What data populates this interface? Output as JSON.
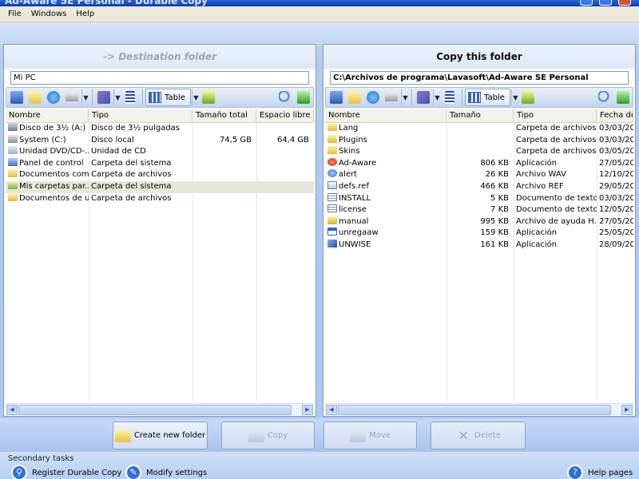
{
  "window": {
    "title": "Ad-Aware SE Personal - Durable Copy"
  },
  "menu": [
    {
      "label": "File",
      "key": "F"
    },
    {
      "label": "Windows",
      "key": "W"
    },
    {
      "label": "Help",
      "key": "H"
    }
  ],
  "left_panel": {
    "header": "-> Destination folder",
    "path": "Mi PC",
    "view_label": "Table",
    "columns": [
      "Nombre",
      "Tipo",
      "Tamaño total",
      "Espacio libre"
    ],
    "rows": [
      {
        "name": "Disco de 3½ (A:)",
        "type": "Disco de 3½ pulgadas",
        "total": "",
        "free": "",
        "icon": "floppy-icon"
      },
      {
        "name": "System (C:)",
        "type": "Disco local",
        "total": "74,5 GB",
        "free": "64,4 GB",
        "icon": "hard-drive-icon"
      },
      {
        "name": "Unidad DVD/CD-...",
        "type": "Unidad de CD",
        "total": "",
        "free": "",
        "icon": "cd-drive-icon"
      },
      {
        "name": "Panel de control",
        "type": "Carpeta del sistema",
        "total": "",
        "free": "",
        "icon": "control-panel-icon"
      },
      {
        "name": "Documentos com...",
        "type": "Carpeta de archivos",
        "total": "",
        "free": "",
        "icon": "folder-icon"
      },
      {
        "name": "Mis carpetas par...",
        "type": "Carpeta del sistema",
        "total": "",
        "free": "",
        "icon": "shared-folder-icon"
      },
      {
        "name": "Documentos de u...",
        "type": "Carpeta de archivos",
        "total": "",
        "free": "",
        "icon": "folder-icon"
      }
    ]
  },
  "right_panel": {
    "header": "Copy this folder",
    "path": "C:\\Archivos de programa\\Lavasoft\\Ad-Aware SE Personal",
    "view_label": "Table",
    "columns": [
      "Nombre",
      "Tamaño",
      "Tipo",
      "Fecha de modificación"
    ],
    "rows": [
      {
        "name": "Lang",
        "size": "",
        "type": "Carpeta de archivos",
        "date": "03/03/20",
        "icon": "folder-icon"
      },
      {
        "name": "Plugins",
        "size": "",
        "type": "Carpeta de archivos",
        "date": "03/03/20",
        "icon": "folder-icon"
      },
      {
        "name": "Skins",
        "size": "",
        "type": "Carpeta de archivos",
        "date": "03/05/20",
        "icon": "folder-icon"
      },
      {
        "name": "Ad-Aware",
        "size": "806 KB",
        "type": "Aplicación",
        "date": "27/05/20",
        "icon": "ad-aware-app-icon"
      },
      {
        "name": "alert",
        "size": "26 KB",
        "type": "Archivo WAV",
        "date": "12/10/20",
        "icon": "audio-file-icon"
      },
      {
        "name": "defs.ref",
        "size": "466 KB",
        "type": "Archivo REF",
        "date": "29/05/20",
        "icon": "file-icon"
      },
      {
        "name": "INSTALL",
        "size": "5 KB",
        "type": "Documento de texto",
        "date": "03/03/20",
        "icon": "text-file-icon"
      },
      {
        "name": "license",
        "size": "7 KB",
        "type": "Documento de texto",
        "date": "12/05/20",
        "icon": "text-file-icon"
      },
      {
        "name": "manual",
        "size": "995 KB",
        "type": "Archivo de ayuda H...",
        "date": "27/05/20",
        "icon": "help-file-icon"
      },
      {
        "name": "unregaaw",
        "size": "159 KB",
        "type": "Aplicación",
        "date": "25/05/20",
        "icon": "app-window-icon"
      },
      {
        "name": "UNWISE",
        "size": "161 KB",
        "type": "Aplicación",
        "date": "28/09/20",
        "icon": "installer-icon"
      }
    ]
  },
  "actions": {
    "create_folder": "Create new folder",
    "copy": "Copy",
    "move": "Move",
    "delete": "Delete"
  },
  "secondary": {
    "label": "Secondary tasks",
    "register": "Register Durable Copy",
    "modify": "Modify settings",
    "help": "Help pages"
  },
  "colors": {
    "accent": "#2f64c8",
    "panel_bg": "#ffffff",
    "window_bg": "#b4cbef"
  }
}
